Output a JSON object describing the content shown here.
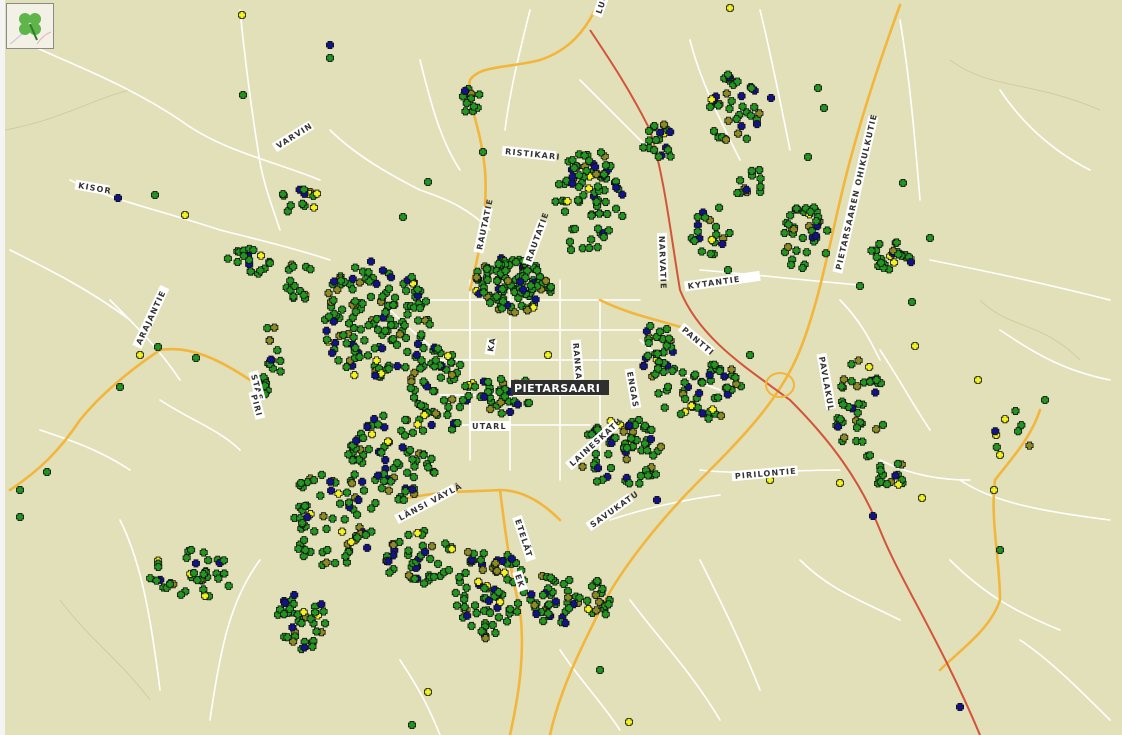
{
  "map": {
    "town_label": "PIETARSAARI",
    "road_labels": [
      {
        "id": "luodontie",
        "text": "LUO"
      },
      {
        "id": "varvintie",
        "text": "VARVIN"
      },
      {
        "id": "kisor",
        "text": "KISOR"
      },
      {
        "id": "ristikari",
        "text": "RISTIKARI"
      },
      {
        "id": "rautatie",
        "text": "RAUTATIE"
      },
      {
        "id": "rautatienk",
        "text": "RAUTATIE"
      },
      {
        "id": "narvatie",
        "text": "NARVATIE"
      },
      {
        "id": "kytantie",
        "text": "KYTANTIE"
      },
      {
        "id": "pietarsaaren-ohikulku",
        "text": "PIETARSAAREN OHIKULKUTIE"
      },
      {
        "id": "arajantie",
        "text": "ARAJANTIE"
      },
      {
        "id": "pantti",
        "text": "PANTTI"
      },
      {
        "id": "pavlakul",
        "text": "PAVLAKUL"
      },
      {
        "id": "sitas",
        "text": "STAS"
      },
      {
        "id": "kaupunki",
        "text": "KA"
      },
      {
        "id": "rantakatu",
        "text": "RANKA"
      },
      {
        "id": "tuomikatu",
        "text": "UTARL"
      },
      {
        "id": "launeskatu",
        "text": "LAINESKATU"
      },
      {
        "id": "pirilontie",
        "text": "PIRILONTIE"
      },
      {
        "id": "lansi-vayla",
        "text": "LÄNSI VÄYLÄ"
      },
      {
        "id": "etelatie",
        "text": "ETELÄT"
      },
      {
        "id": "savukatu",
        "text": "SAVUKATU"
      },
      {
        "id": "tie-ek",
        "text": "EK"
      },
      {
        "id": "pir-w",
        "text": "PIRI"
      },
      {
        "id": "enga",
        "text": "ENGAS"
      }
    ]
  },
  "legend": {
    "marker_colors": {
      "green": "#22961f",
      "blue": "#12128a",
      "olive": "#8b8b24",
      "yellow": "#f2f21c",
      "marker_outline": "#111111"
    },
    "base_colors": {
      "background": "#e2e0b9",
      "minor_road": "#ffffff",
      "main_road": "#f2b63c",
      "highway": "#d2543a",
      "water_line": "#bfc4a0"
    }
  },
  "icons": {
    "overview": "four-leaf-clover-icon",
    "marker": "plus-marker-icon"
  }
}
